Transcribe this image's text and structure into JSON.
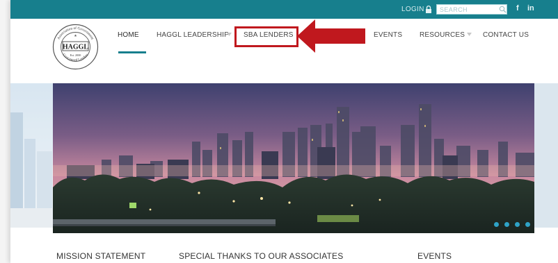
{
  "topbar": {
    "login_label": "LOGIN",
    "search_placeholder": "SEARCH",
    "social": [
      "f",
      "in"
    ]
  },
  "logo": {
    "ring_top": "Association of Government",
    "ring_bottom": "Guaranteed Lenders",
    "center": "HAGGL",
    "est": "Est. 2000"
  },
  "nav": {
    "items": [
      "HOME",
      "HAGGL LEADERSHIP",
      "SBA LENDERS",
      "EVENTS",
      "RESOURCES",
      "CONTACT US"
    ],
    "active": "HOME",
    "highlighted": "SBA LENDERS"
  },
  "slider": {
    "slide_count": 4,
    "active_slide": 1
  },
  "sections": {
    "mission": "MISSION STATEMENT",
    "thanks": "SPECIAL THANKS TO OUR ASSOCIATES",
    "events": "EVENTS"
  },
  "colors": {
    "teal": "#177f8d",
    "highlight_red": "#c0181e",
    "slider_dot": "#2fa3c7"
  }
}
